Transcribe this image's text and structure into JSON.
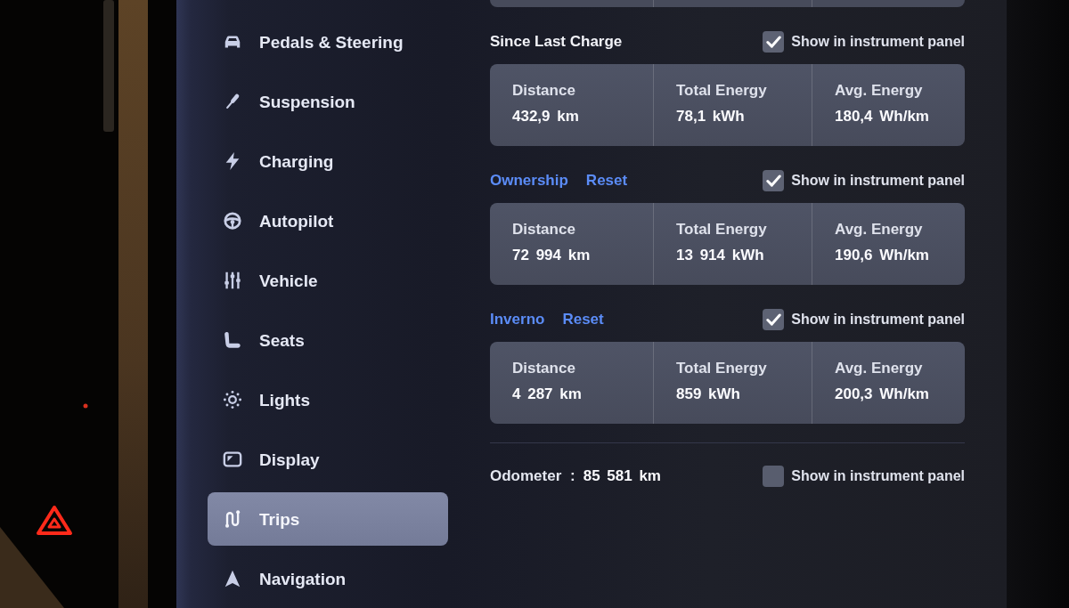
{
  "dashboard": {
    "hazard_light": {
      "on": true
    }
  },
  "sidebar": {
    "items": [
      {
        "label": "Pedals & Steering",
        "selected": false
      },
      {
        "label": "Suspension",
        "selected": false
      },
      {
        "label": "Charging",
        "selected": false
      },
      {
        "label": "Autopilot",
        "selected": false
      },
      {
        "label": "Vehicle",
        "selected": false
      },
      {
        "label": "Seats",
        "selected": false
      },
      {
        "label": "Lights",
        "selected": false
      },
      {
        "label": "Display",
        "selected": false
      },
      {
        "label": "Trips",
        "selected": true
      },
      {
        "label": "Navigation",
        "selected": false
      }
    ]
  },
  "trips": {
    "sections": [
      {
        "kind": "fixed",
        "title": "Since Last Charge",
        "show_in_panel": {
          "label": "Show in instrument panel",
          "checked": true
        },
        "stats": [
          {
            "label": "Distance",
            "value": "432,9 km"
          },
          {
            "label": "Total Energy",
            "value": "78,1 kWh"
          },
          {
            "label": "Avg. Energy",
            "value": "180,4 Wh/km"
          }
        ]
      },
      {
        "kind": "resettable",
        "title": "Ownership",
        "reset": "Reset",
        "show_in_panel": {
          "label": "Show in instrument panel",
          "checked": true
        },
        "stats": [
          {
            "label": "Distance",
            "value": "72 994 km"
          },
          {
            "label": "Total Energy",
            "value": "13 914 kWh"
          },
          {
            "label": "Avg. Energy",
            "value": "190,6 Wh/km"
          }
        ]
      },
      {
        "kind": "resettable",
        "title": "Inverno",
        "reset": "Reset",
        "show_in_panel": {
          "label": "Show in instrument panel",
          "checked": true
        },
        "stats": [
          {
            "label": "Distance",
            "value": "4 287 km"
          },
          {
            "label": "Total Energy",
            "value": "859 kWh"
          },
          {
            "label": "Avg. Energy",
            "value": "200,3 Wh/km"
          }
        ]
      }
    ],
    "odometer": {
      "label": "Odometer :",
      "value": "85 581 km",
      "show_in_panel": {
        "label": "Show in instrument panel",
        "checked": false
      }
    }
  }
}
